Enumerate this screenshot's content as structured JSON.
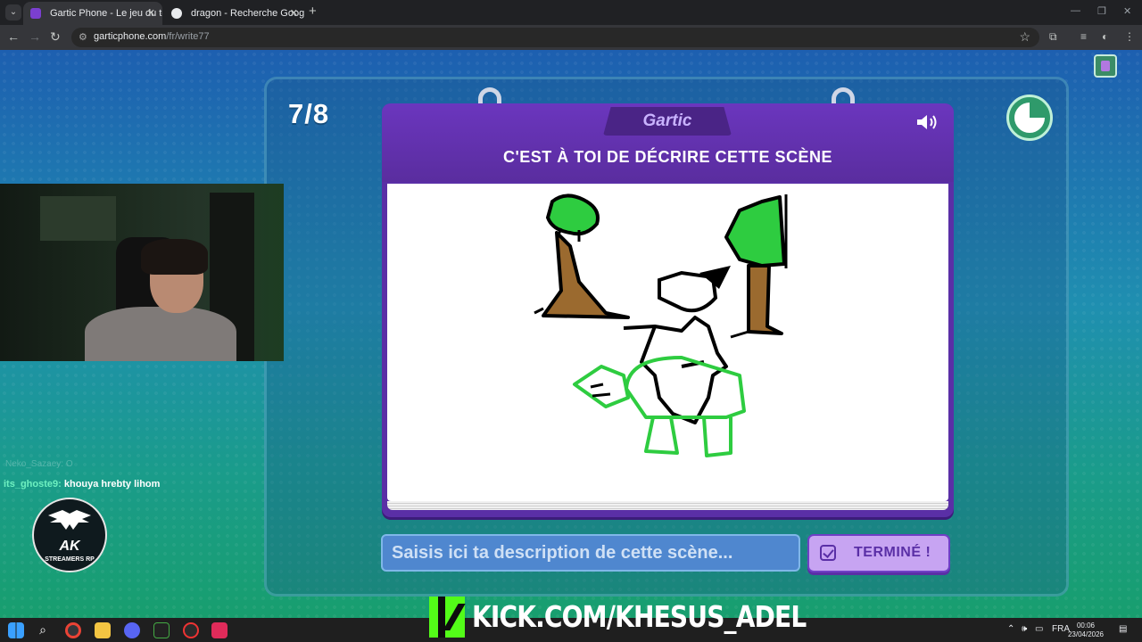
{
  "browser": {
    "tabs": [
      {
        "title": "Gartic Phone - Le jeu du téléphone",
        "active": true
      },
      {
        "title": "dragon - Recherche Google",
        "active": false
      }
    ],
    "url_host": "garticphone.com",
    "url_path": "/fr/write77"
  },
  "game": {
    "round": "7/8",
    "logo": "Gartic",
    "instruction": "C'EST À TOI DE DÉCRIRE CETTE SCÈNE",
    "input_placeholder": "Saisis ici ta description de cette scène...",
    "input_value": "",
    "done_label": "TERMINÉ !",
    "timer_remaining": 0.75
  },
  "overlay": {
    "chat_faded": "Neko_Sazaey: O",
    "chat_user": "its_ghoste9:",
    "chat_message": "khouya hrebty lihom",
    "logo_main": "AK",
    "logo_sub": "STREAMERS RP",
    "kick_text": "KICK.COM/KHESUS_ADEL"
  },
  "taskbar": {
    "language": "FRA",
    "time": "00:06",
    "date": "23/04/2026"
  },
  "colors": {
    "card_purple": "#5a2fa6",
    "done_button": "#c7a4f2",
    "kick_green": "#53fc18",
    "drawing_green": "#2ecc40",
    "drawing_brown": "#9b6a2f"
  }
}
